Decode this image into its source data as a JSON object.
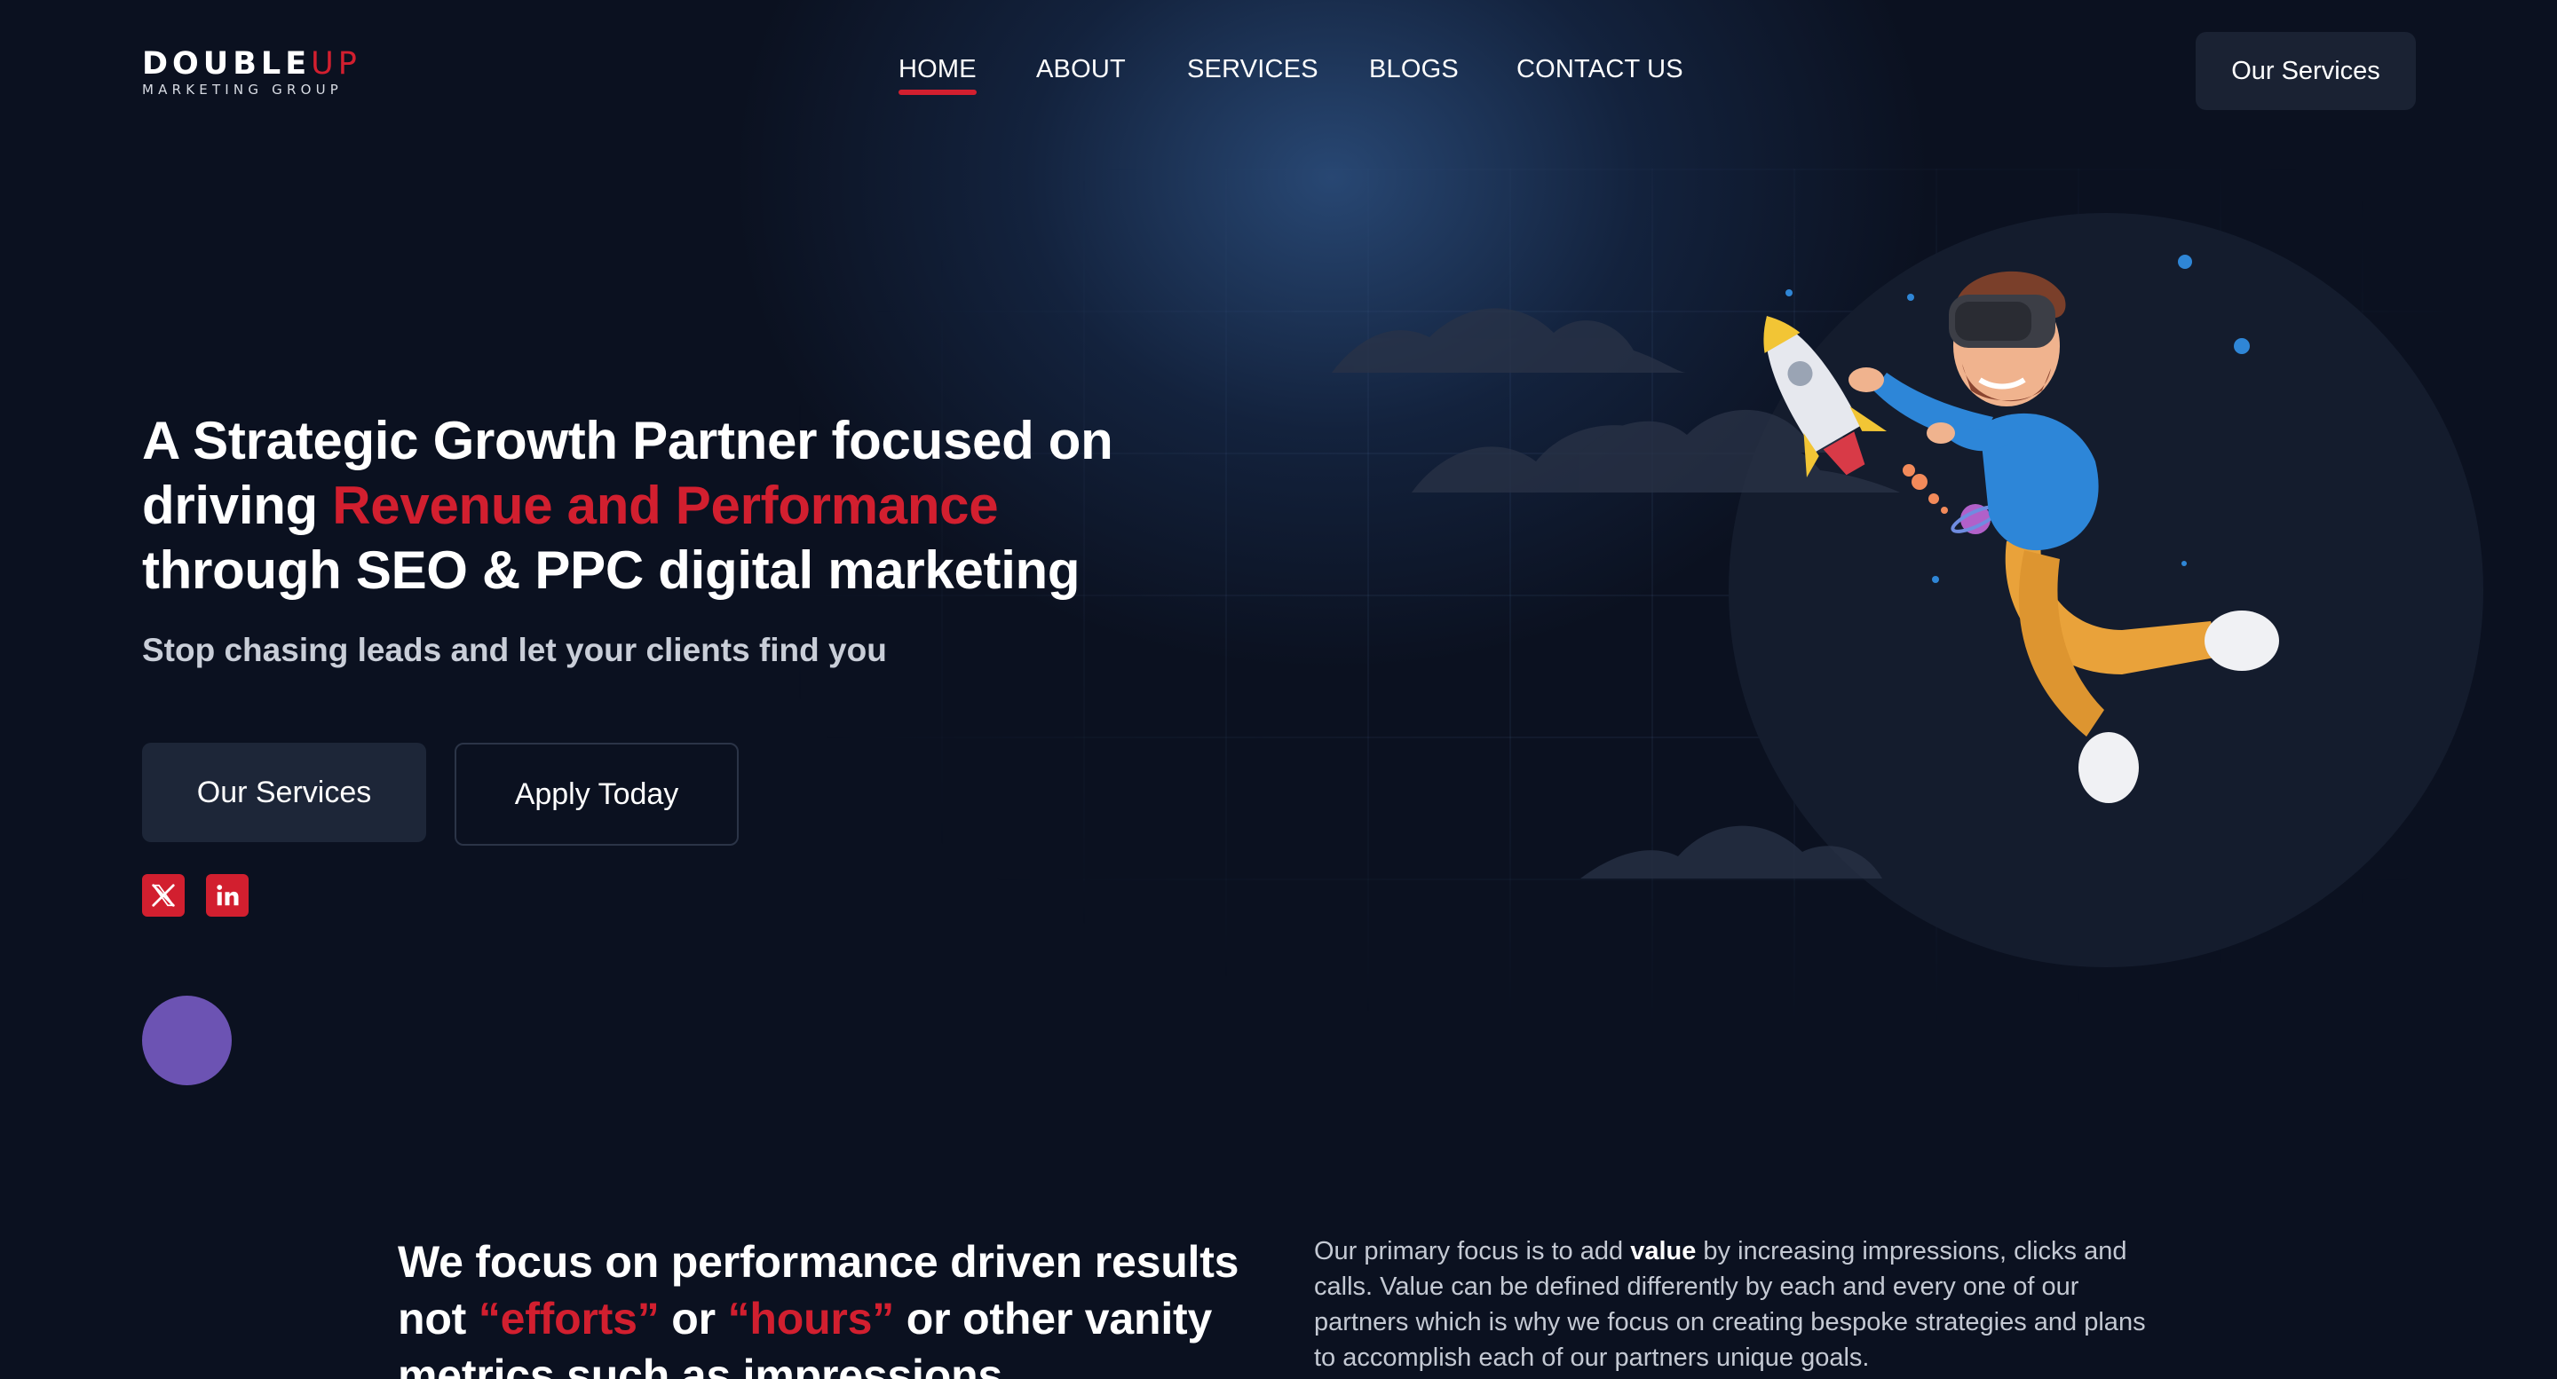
{
  "brand": {
    "logo_main": "DOUBLE",
    "logo_accent": "UP",
    "logo_sub": "MARKETING GROUP",
    "accent_color": "#d21f2f",
    "background_color": "#0b1120"
  },
  "nav": {
    "items": [
      {
        "label": "HOME",
        "active": true
      },
      {
        "label": "ABOUT",
        "active": false
      },
      {
        "label": "SERVICES",
        "active": false
      },
      {
        "label": "BLOGS",
        "active": false
      },
      {
        "label": "CONTACT US",
        "active": false
      }
    ],
    "cta_label": "Our Services"
  },
  "hero": {
    "title_part1": "A Strategic Growth Partner focused on driving ",
    "title_highlight": "Revenue and Performance",
    "title_part2": " through SEO & PPC digital marketing",
    "subtitle": "Stop chasing leads and let your clients find you",
    "primary_button": "Our Services",
    "secondary_button": "Apply Today",
    "social": [
      {
        "icon": "x-twitter-icon"
      },
      {
        "icon": "linkedin-icon"
      }
    ],
    "illustration": "vr-man-with-rocket-illustration"
  },
  "focus": {
    "title_part1": "We focus on performance driven results not ",
    "title_highlight1": "“efforts”",
    "title_mid": " or ",
    "title_highlight2": "“hours”",
    "title_part2": " or other vanity metrics such as impressions",
    "text_part1": "Our primary focus is to add ",
    "text_bold": "value",
    "text_part2": " by increasing impressions, clicks and calls. Value can be defined differently by each and every one of our partners which is why we focus on creating bespoke strategies and plans to accomplish each of our partners unique goals."
  }
}
